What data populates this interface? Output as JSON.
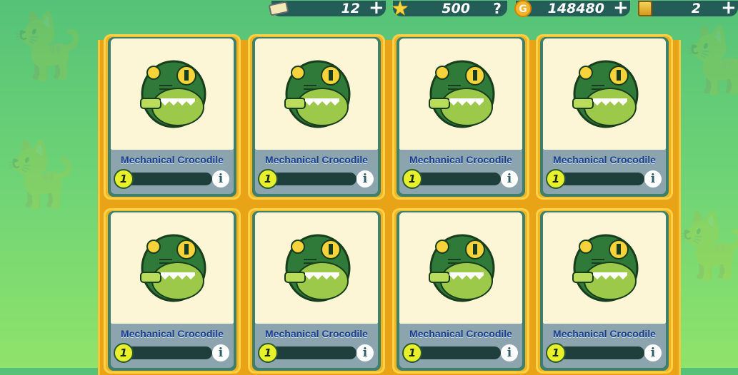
{
  "currencies": {
    "tickets": {
      "value": "12",
      "icon": "ticket-icon"
    },
    "stars": {
      "value": "500",
      "icon": "star-icon"
    },
    "coins": {
      "value": "148480",
      "icon": "coin-icon"
    },
    "chests": {
      "value": "2",
      "icon": "chest-icon"
    }
  },
  "cards": [
    {
      "name": "Mechanical Crocodile",
      "level": "1"
    },
    {
      "name": "Mechanical Crocodile",
      "level": "1"
    },
    {
      "name": "Mechanical Crocodile",
      "level": "1"
    },
    {
      "name": "Mechanical Crocodile",
      "level": "1"
    },
    {
      "name": "Mechanical Crocodile",
      "level": "1"
    },
    {
      "name": "Mechanical Crocodile",
      "level": "1"
    },
    {
      "name": "Mechanical Crocodile",
      "level": "1"
    },
    {
      "name": "Mechanical Crocodile",
      "level": "1"
    }
  ],
  "colors": {
    "accent": "#f4b51c",
    "panel": "#3f7f6d",
    "background": "#6fd476"
  }
}
